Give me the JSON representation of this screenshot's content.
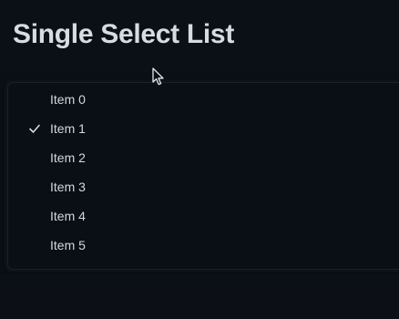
{
  "page": {
    "title": "Single Select List"
  },
  "list": {
    "selected_index": 1,
    "items": [
      {
        "label": "Item 0",
        "selected": false
      },
      {
        "label": "Item 1",
        "selected": true
      },
      {
        "label": "Item 2",
        "selected": false
      },
      {
        "label": "Item 3",
        "selected": false
      },
      {
        "label": "Item 4",
        "selected": false
      },
      {
        "label": "Item 5",
        "selected": false
      }
    ]
  },
  "icons": {
    "selected_marker": "check-icon",
    "pointer": "mouse-cursor-icon"
  },
  "colors": {
    "background": "#0b0f16",
    "text": "#d3d7de",
    "title": "#d7dbe2"
  }
}
